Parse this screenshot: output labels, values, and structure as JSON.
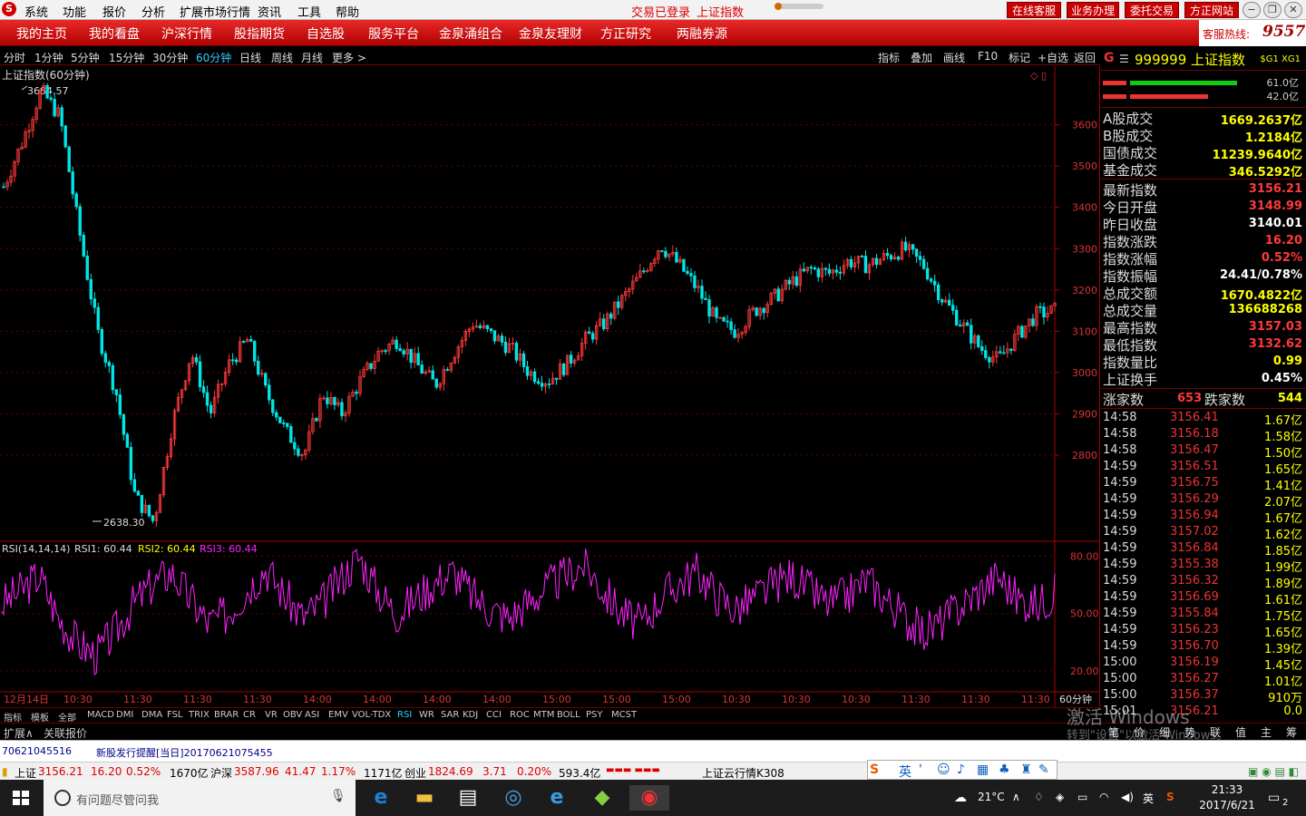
{
  "app": {
    "menu": [
      "系统",
      "功能",
      "报价",
      "分析",
      "扩展市场行情",
      "资讯",
      "工具",
      "帮助"
    ],
    "login_status": "交易已登录",
    "current_index_name": "上证指数",
    "right_buttons": [
      "在线客服",
      "业务办理",
      "委托交易",
      "方正网站"
    ]
  },
  "nav": {
    "items": [
      "我的主页",
      "我的看盘",
      "沪深行情",
      "股指期货",
      "自选股",
      "服务平台",
      "金泉涌组合",
      "金泉友理财",
      "方正研究",
      "两融券源"
    ],
    "hotline_label": "客服热线:",
    "hotline_number": "95571"
  },
  "toolbar": {
    "periods": [
      "分时",
      "1分钟",
      "5分钟",
      "15分钟",
      "30分钟",
      "60分钟",
      "日线",
      "周线",
      "月线",
      "更多 >"
    ],
    "selected_period": "60分钟",
    "tools": [
      "指标",
      "叠加",
      "画线",
      "F10",
      "标记",
      "+自选",
      "返回"
    ]
  },
  "chart": {
    "title": "上证指数(60分钟)",
    "high_label": "3684.57",
    "low_label": "2638.30",
    "price_axis": [
      "3600",
      "3500",
      "3400",
      "3300",
      "3200",
      "3100",
      "3000",
      "2900",
      "2800"
    ],
    "rsi_title": "RSI(14,14,14)",
    "rsi1": "RSI1: 60.44",
    "rsi2": "RSI2: 60.44",
    "rsi3": "RSI3: 60.44",
    "rsi_axis": [
      "80.00",
      "50.00",
      "20.00"
    ],
    "time_axis": [
      "12月14日",
      "10:30",
      "11:30",
      "11:30",
      "11:30",
      "14:00",
      "14:00",
      "14:00",
      "14:00",
      "15:00",
      "15:00",
      "15:00",
      "10:30",
      "10:30",
      "10:30",
      "11:30",
      "11:30",
      "11:30"
    ],
    "period_tag": "60分钟"
  },
  "chart_data": {
    "type": "line",
    "title": "上证指数(60分钟)",
    "ylim": [
      2600,
      3720
    ],
    "series": [
      {
        "name": "上证指数",
        "values": [
          3450,
          3560,
          3684,
          3620,
          3350,
          3100,
          2950,
          2700,
          2638,
          2880,
          3050,
          2900,
          3020,
          3080,
          2950,
          2860,
          2800,
          2950,
          2900,
          2980,
          3050,
          3080,
          3020,
          2970,
          3050,
          3120,
          3090,
          3060,
          3000,
          2980,
          3020,
          3080,
          3120,
          3180,
          3240,
          3310,
          3260,
          3200,
          3120,
          3100,
          3150,
          3180,
          3220,
          3250,
          3240,
          3270,
          3260,
          3280,
          3300,
          3260,
          3180,
          3120,
          3060,
          3030,
          3090,
          3140,
          3150
        ]
      },
      {
        "name": "RSI",
        "values": [
          55,
          62,
          70,
          48,
          35,
          28,
          40,
          55,
          65,
          72,
          58,
          45,
          50,
          62,
          74,
          60,
          48,
          55,
          68,
          80,
          62,
          50,
          58,
          66,
          72,
          60,
          52,
          48,
          56,
          64,
          70,
          76,
          62,
          50,
          44,
          58,
          66,
          72,
          60,
          52,
          58,
          65,
          70,
          62,
          55,
          60,
          68,
          58,
          48,
          40,
          46,
          54,
          62,
          70,
          58,
          55,
          60
        ]
      }
    ]
  },
  "panel": {
    "code": "999999",
    "name": "上证指数",
    "tag": "$G1 XG1",
    "bar1_label": "61.0亿",
    "bar2_label": "42.0亿",
    "stats1": [
      {
        "k": "A股成交",
        "v": "1669.2637亿",
        "c": "#ff0"
      },
      {
        "k": "B股成交",
        "v": "1.2184亿",
        "c": "#ff0"
      },
      {
        "k": "国债成交",
        "v": "11239.9640亿",
        "c": "#ff0"
      },
      {
        "k": "基金成交",
        "v": "346.5292亿",
        "c": "#ff0"
      }
    ],
    "stats2": [
      {
        "k": "最新指数",
        "v": "3156.21",
        "c": "#ff3a3a"
      },
      {
        "k": "今日开盘",
        "v": "3148.99",
        "c": "#ff3a3a"
      },
      {
        "k": "昨日收盘",
        "v": "3140.01",
        "c": "#fff"
      },
      {
        "k": "指数涨跌",
        "v": "16.20",
        "c": "#ff3a3a"
      },
      {
        "k": "指数涨幅",
        "v": "0.52%",
        "c": "#ff3a3a"
      },
      {
        "k": "指数振幅",
        "v": "24.41/0.78%",
        "c": "#fff"
      },
      {
        "k": "总成交额",
        "v": "1670.4822亿",
        "c": "#ff0"
      },
      {
        "k": "总成交量",
        "v": "136688268",
        "c": "#ff0"
      },
      {
        "k": "最高指数",
        "v": "3157.03",
        "c": "#ff3a3a"
      },
      {
        "k": "最低指数",
        "v": "3132.62",
        "c": "#ff3a3a"
      },
      {
        "k": "指数量比",
        "v": "0.99",
        "c": "#ff0"
      },
      {
        "k": "上证换手",
        "v": "0.45%",
        "c": "#fff"
      }
    ],
    "up_label": "涨家数",
    "up_value": "653",
    "down_label": "跌家数",
    "down_value": "544",
    "ticks": [
      {
        "t": "14:58",
        "p": "3156.41",
        "v": "1.67亿"
      },
      {
        "t": "14:58",
        "p": "3156.18",
        "v": "1.58亿"
      },
      {
        "t": "14:58",
        "p": "3156.47",
        "v": "1.50亿"
      },
      {
        "t": "14:59",
        "p": "3156.51",
        "v": "1.65亿"
      },
      {
        "t": "14:59",
        "p": "3156.75",
        "v": "1.41亿"
      },
      {
        "t": "14:59",
        "p": "3156.29",
        "v": "2.07亿"
      },
      {
        "t": "14:59",
        "p": "3156.94",
        "v": "1.67亿"
      },
      {
        "t": "14:59",
        "p": "3157.02",
        "v": "1.62亿"
      },
      {
        "t": "14:59",
        "p": "3156.84",
        "v": "1.85亿"
      },
      {
        "t": "14:59",
        "p": "3155.38",
        "v": "1.99亿"
      },
      {
        "t": "14:59",
        "p": "3156.32",
        "v": "1.89亿"
      },
      {
        "t": "14:59",
        "p": "3156.69",
        "v": "1.61亿"
      },
      {
        "t": "14:59",
        "p": "3155.84",
        "v": "1.75亿"
      },
      {
        "t": "14:59",
        "p": "3156.23",
        "v": "1.65亿"
      },
      {
        "t": "14:59",
        "p": "3156.70",
        "v": "1.39亿"
      },
      {
        "t": "15:00",
        "p": "3156.19",
        "v": "1.45亿"
      },
      {
        "t": "15:00",
        "p": "3156.27",
        "v": "1.01亿"
      },
      {
        "t": "15:00",
        "p": "3156.37",
        "v": "910万"
      },
      {
        "t": "15:01",
        "p": "3156.21",
        "v": "0.0"
      }
    ],
    "tabs": [
      "笔",
      "价",
      "细",
      "势",
      "联",
      "值",
      "主",
      "筹"
    ]
  },
  "bottom": {
    "indicator_tabs": [
      "指标",
      "模板",
      "全部",
      "MACD",
      "DMI",
      "DMA",
      "FSL",
      "TRIX",
      "BRAR",
      "CR",
      "VR",
      "OBV",
      "ASI",
      "EMV",
      "VOL-TDX",
      "RSI",
      "WR",
      "SAR",
      "KDJ",
      "CCI",
      "ROC",
      "MTM",
      "BOLL",
      "PSY",
      "MCST"
    ],
    "selected_tab": "RSI",
    "expand_label": "扩展∧",
    "linked_label": "关联报价",
    "news_id": "70621045516",
    "news_text": "新股发行提醒[当日]20170621075455",
    "status": {
      "sh_name": "上证",
      "sh_val": "3156.21",
      "sh_chg": "16.20",
      "sh_pct": "0.52%",
      "sh_amt": "1670亿",
      "hs_name": "沪深",
      "hs_val": "3587.96",
      "hs_chg": "41.47",
      "hs_pct": "1.17%",
      "hs_amt": "1171亿",
      "cy_name": "创业",
      "cy_val": "1824.69",
      "cy_chg": "3.71",
      "cy_pct": "0.20%",
      "cy_amt": "593.4亿",
      "cloud": "上证云行情K308"
    },
    "watermark": "激活 Windows",
    "watermark2": "转到\"设置\"以激活 Windows。"
  },
  "taskbar": {
    "search_placeholder": "有问题尽管问我",
    "weather": "21°C",
    "lang": "英",
    "time": "21:33",
    "date": "2017/6/21",
    "notif_count": "2"
  },
  "colors": {
    "up": "#ff3a3a",
    "down": "#00e5e5",
    "rsi": "#ff22ff",
    "accent": "#c80000"
  }
}
